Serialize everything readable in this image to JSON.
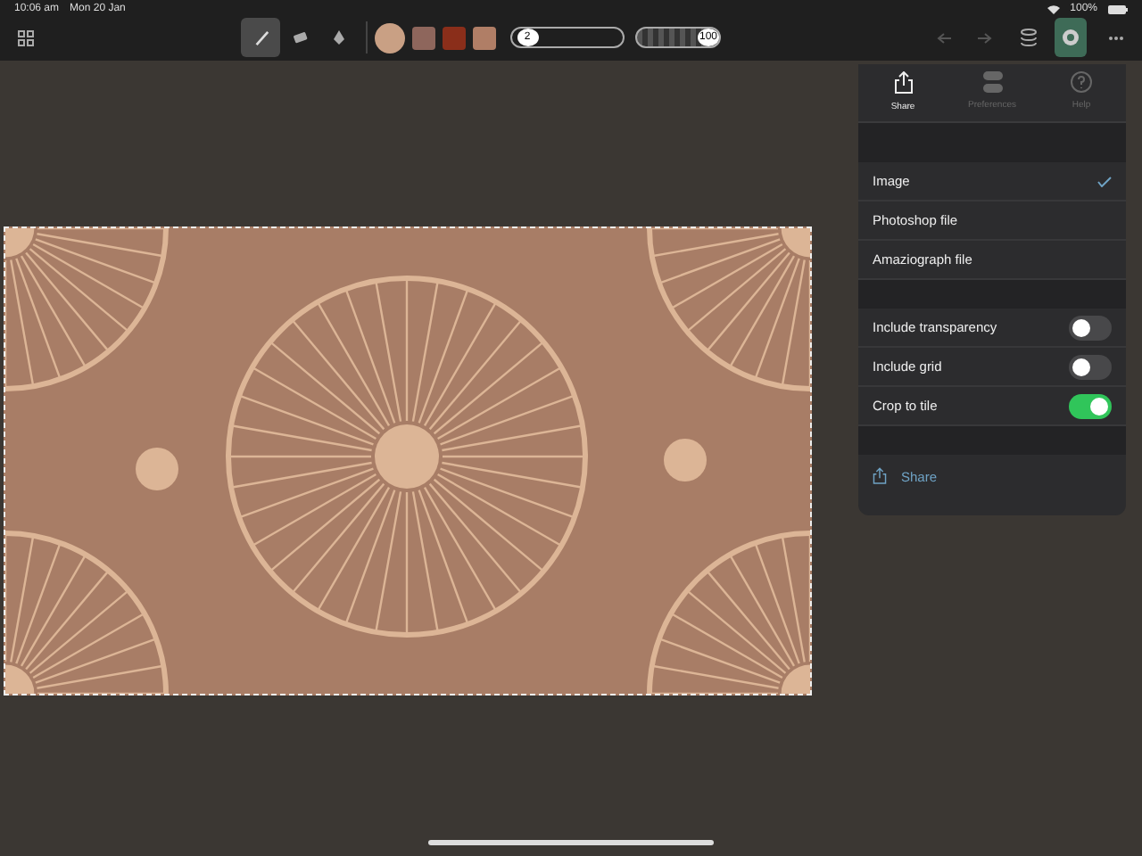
{
  "status_bar": {
    "time": "10:06 am",
    "date": "Mon 20 Jan",
    "battery": "100%"
  },
  "toolbar": {
    "tools": [
      {
        "kind": "brush",
        "selected": true
      },
      {
        "kind": "eraser",
        "selected": false
      },
      {
        "kind": "fill",
        "selected": false
      }
    ],
    "colors": [
      {
        "color": "#c9a084",
        "selected": true
      },
      {
        "color": "#8e665c",
        "selected": false
      },
      {
        "color": "#8a2e1a",
        "selected": false
      },
      {
        "color": "#b07e66",
        "selected": false
      }
    ],
    "brush_size": {
      "reading": "2",
      "level": 0.05
    },
    "opacity": {
      "reading": "100",
      "level": 1
    },
    "pattern_button": {
      "selected": true
    }
  },
  "panel": {
    "tabs": [
      {
        "label": "Share",
        "kind": "share",
        "selected": true
      },
      {
        "label": "Preferences",
        "kind": "prefs",
        "selected": false
      },
      {
        "label": "Help",
        "kind": "help",
        "selected": false
      }
    ],
    "formats": [
      {
        "label": "Image",
        "selected": true
      },
      {
        "label": "Photoshop file",
        "selected": false
      },
      {
        "label": "Amaziograph file",
        "selected": false
      }
    ],
    "options": [
      {
        "label": "Include transparency",
        "on": false
      },
      {
        "label": "Include grid",
        "on": false
      },
      {
        "label": "Crop to tile",
        "on": true
      }
    ],
    "share_button": "Share"
  }
}
